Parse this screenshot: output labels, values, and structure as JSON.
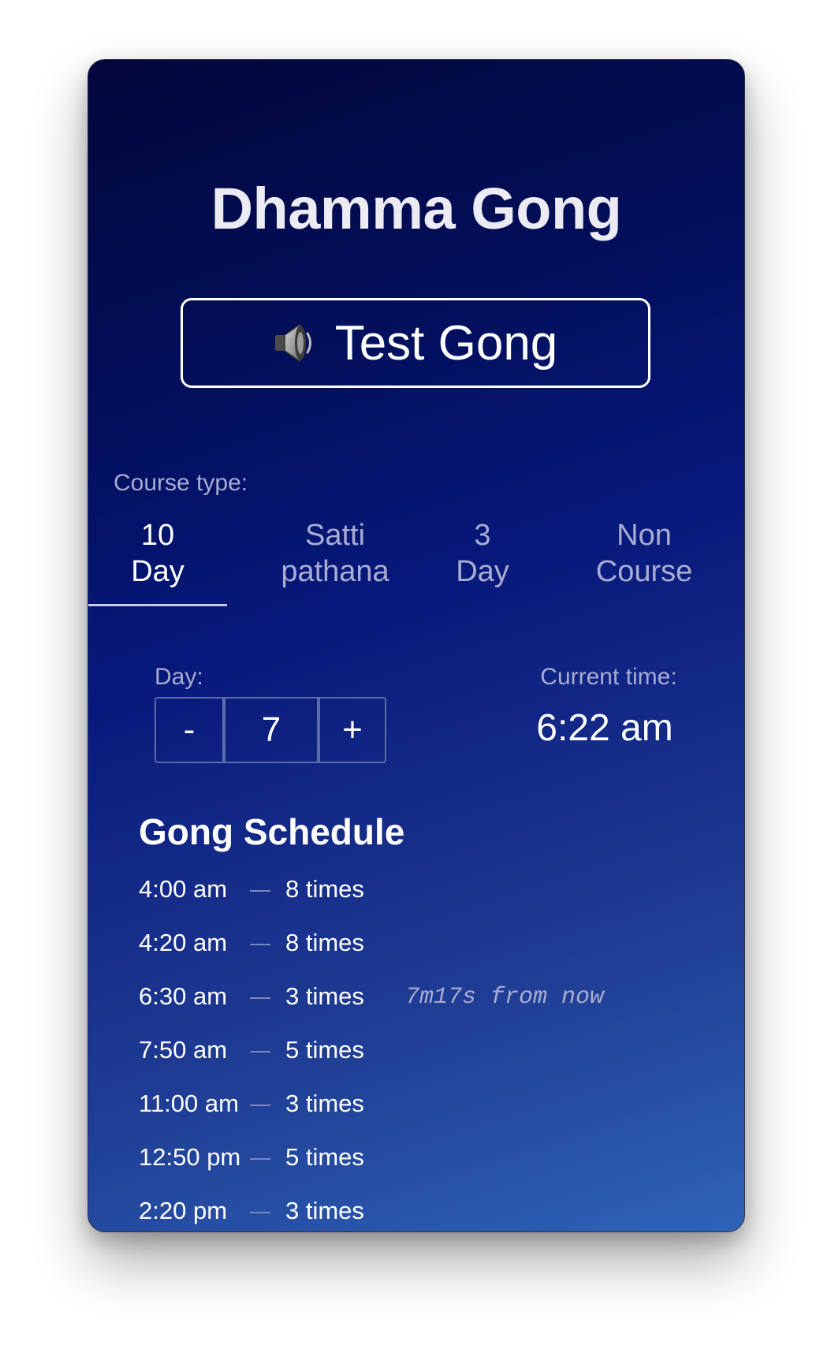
{
  "app": {
    "title": "Dhamma Gong"
  },
  "test_gong": {
    "icon": "speaker-icon",
    "label": "Test Gong"
  },
  "course": {
    "label": "Course type:",
    "tabs": [
      {
        "line1": "10",
        "line2": "Day",
        "active": true
      },
      {
        "line1": "Satti",
        "line2": "pathana",
        "active": false
      },
      {
        "line1": "3",
        "line2": "Day",
        "active": false
      },
      {
        "line1": "Non",
        "line2": "Course",
        "active": false
      }
    ]
  },
  "day": {
    "label": "Day:",
    "minus": "-",
    "value": "7",
    "plus": "+"
  },
  "current_time": {
    "label": "Current time:",
    "value": "6:22 am"
  },
  "schedule": {
    "title": "Gong Schedule",
    "rows": [
      {
        "time": "4:00 am",
        "count": "8 times",
        "note": ""
      },
      {
        "time": "4:20 am",
        "count": "8 times",
        "note": ""
      },
      {
        "time": "6:30 am",
        "count": "3 times",
        "note": "7m17s from now"
      },
      {
        "time": "7:50 am",
        "count": "5 times",
        "note": ""
      },
      {
        "time": "11:00 am",
        "count": "3 times",
        "note": ""
      },
      {
        "time": "12:50 pm",
        "count": "5 times",
        "note": ""
      },
      {
        "time": "2:20 pm",
        "count": "3 times",
        "note": ""
      }
    ]
  },
  "colors": {
    "background_top": "#02063a",
    "background_bottom": "#2e64b8",
    "muted_text": "#a9acd2",
    "title_text": "#ecebf3"
  }
}
